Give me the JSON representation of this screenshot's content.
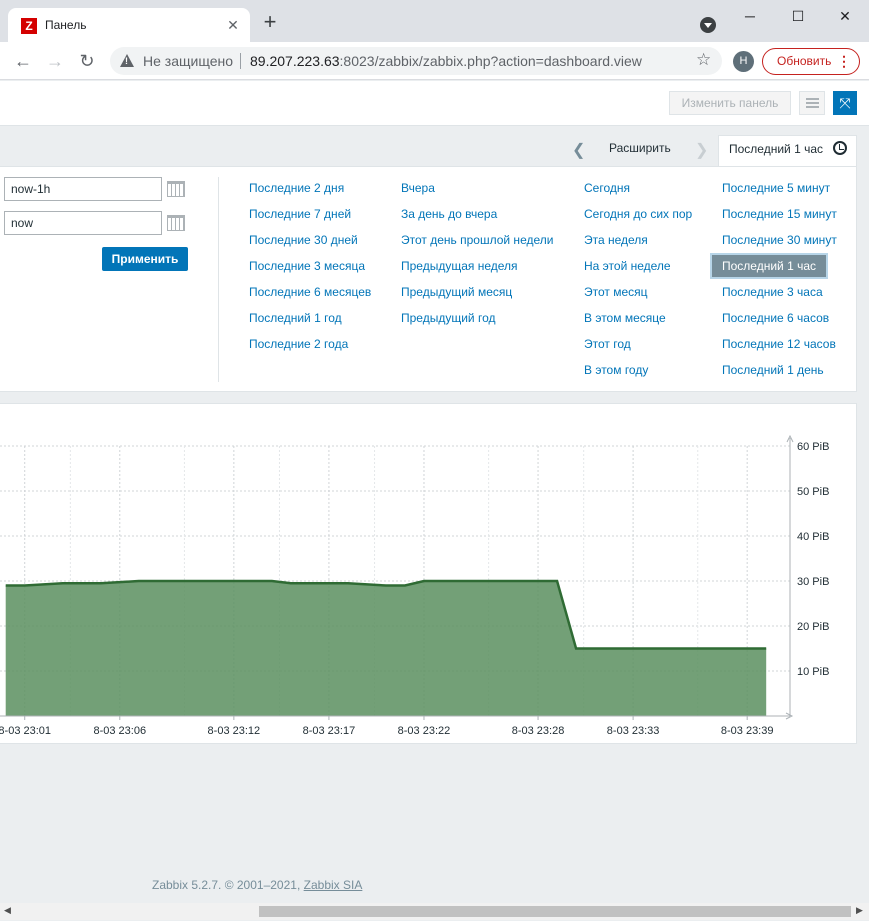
{
  "browser": {
    "tab_title": "Панель",
    "favicon_letter": "Z",
    "security_label": "Не защищено",
    "url_host": "89.207.223.63",
    "url_rest": ":8023/zabbix/zabbix.php?action=dashboard.view",
    "profile_initial": "Н",
    "update_label": "Обновить"
  },
  "header": {
    "edit_dashboard_label": "Изменить панель"
  },
  "time_filter": {
    "zoom_out_label": "Расширить",
    "active_tab_label": "Последний 1 час",
    "from_value": "now-1h",
    "to_value": "now",
    "apply_label": "Применить",
    "quick_ranges": [
      [
        "Последние 2 дня",
        "Последние 7 дней",
        "Последние 30 дней",
        "Последние 3 месяца",
        "Последние 6 месяцев",
        "Последний 1 год",
        "Последние 2 года"
      ],
      [
        "Вчера",
        "За день до вчера",
        "Этот день прошлой недели",
        "Предыдущая неделя",
        "Предыдущий месяц",
        "Предыдущий год"
      ],
      [
        "Сегодня",
        "Сегодня до сих пор",
        "Эта неделя",
        "На этой неделе",
        "Этот месяц",
        "В этом месяце",
        "Этот год",
        "В этом году"
      ],
      [
        "Последние 5 минут",
        "Последние 15 минут",
        "Последние 30 минут",
        "Последний 1 час",
        "Последние 3 часа",
        "Последние 6 часов",
        "Последние 12 часов",
        "Последний 1 день"
      ]
    ],
    "selected_range": "Последний 1 час"
  },
  "chart_data": {
    "type": "area",
    "y_unit": "PiB",
    "ylim": [
      0,
      60
    ],
    "y_ticks": [
      "10 PiB",
      "20 PiB",
      "30 PiB",
      "40 PiB",
      "50 PiB",
      "60 PiB"
    ],
    "x_ticks": [
      "8-03 23:01",
      "8-03 23:06",
      "8-03 23:12",
      "8-03 23:17",
      "8-03 23:22",
      "8-03 23:28",
      "8-03 23:33",
      "8-03 23:39"
    ],
    "grid": true,
    "series": [
      {
        "color": "#5b8f5f",
        "x": [
          "8-03 23:00",
          "8-03 23:01",
          "8-03 23:03",
          "8-03 23:05",
          "8-03 23:07",
          "8-03 23:10",
          "8-03 23:14",
          "8-03 23:15",
          "8-03 23:18",
          "8-03 23:20",
          "8-03 23:21",
          "8-03 23:22",
          "8-03 23:26",
          "8-03 23:29",
          "8-03 23:30",
          "8-03 23:35",
          "8-03 23:40"
        ],
        "values": [
          29,
          29,
          29.5,
          29.5,
          30,
          30,
          30,
          29.5,
          29.5,
          29,
          29,
          30,
          30,
          30,
          15,
          15,
          15
        ]
      }
    ]
  },
  "footer": {
    "text": "Zabbix 5.2.7. © 2001–2021,",
    "link": "Zabbix SIA"
  }
}
